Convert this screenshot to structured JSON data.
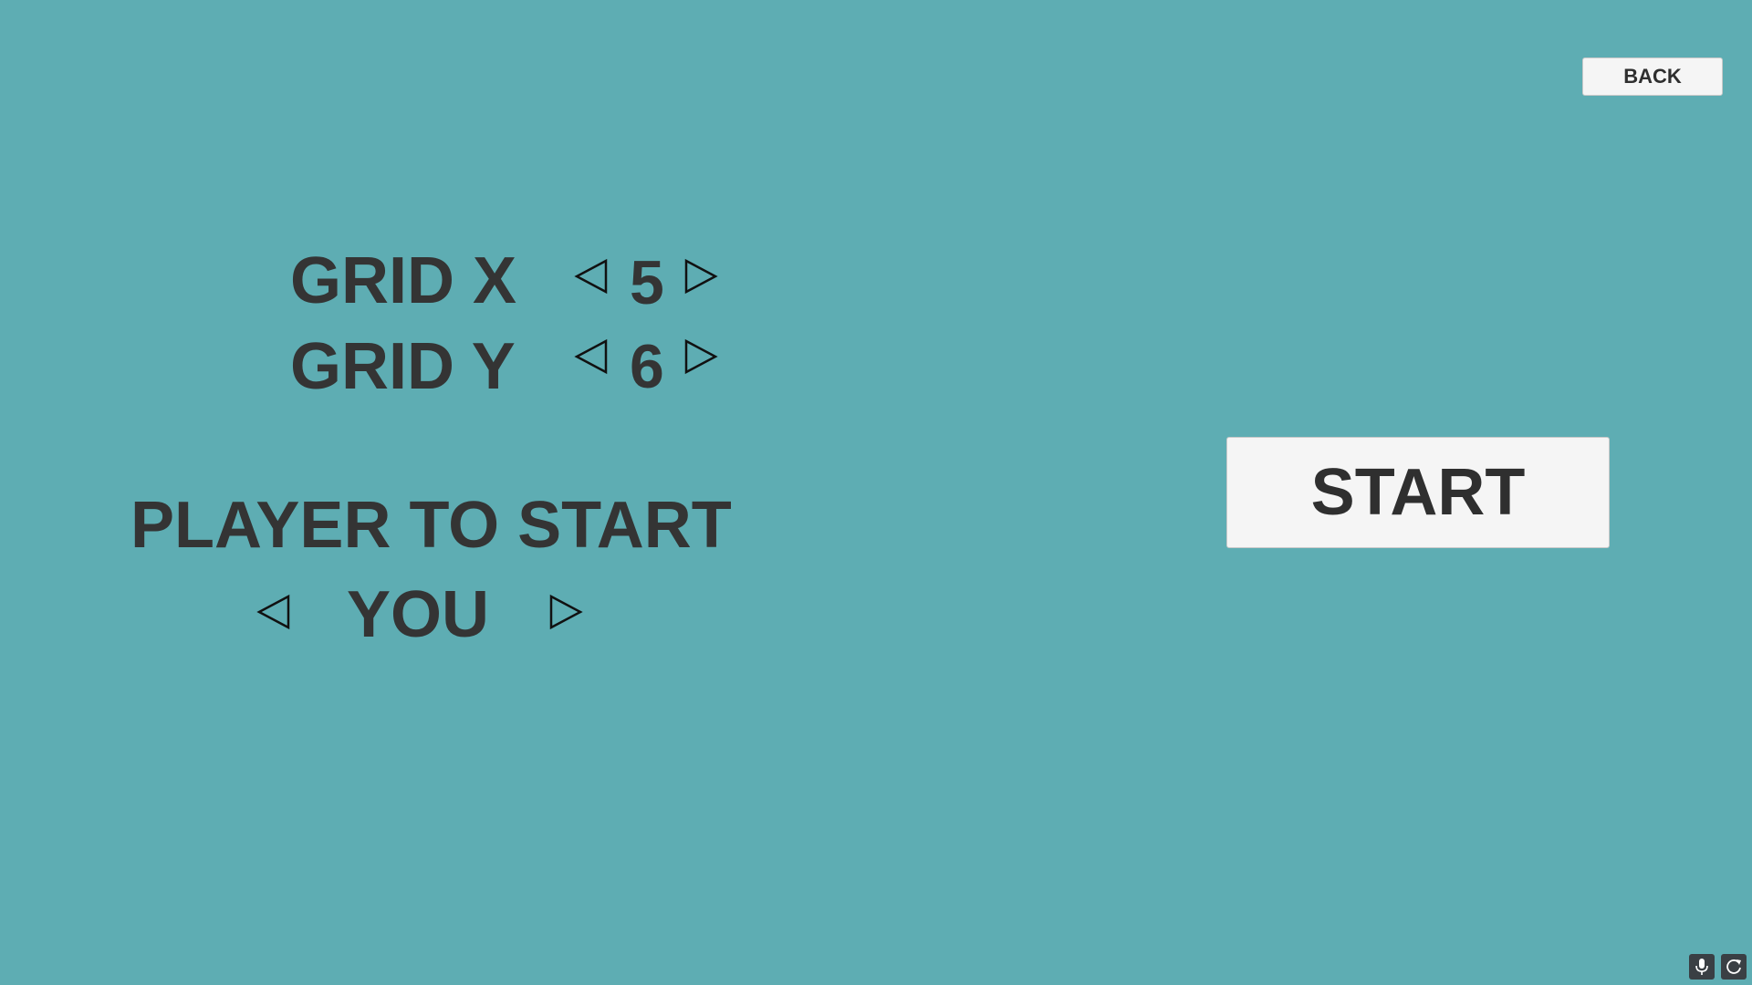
{
  "header": {
    "back_label": "BACK"
  },
  "settings": {
    "grid_x_label": "GRID X",
    "grid_x_value": "5",
    "grid_y_label": "GRID Y",
    "grid_y_value": "6",
    "player_to_start_label": "PLAYER TO START",
    "player_to_start_value": "YOU"
  },
  "actions": {
    "start_label": "START"
  },
  "icons": {
    "decrement": "triangle-left-icon",
    "increment": "triangle-right-icon",
    "mic": "microphone-icon",
    "refresh": "refresh-icon"
  },
  "colors": {
    "background": "#5eadb3",
    "text": "#343434",
    "button_bg": "#f5f5f5"
  }
}
